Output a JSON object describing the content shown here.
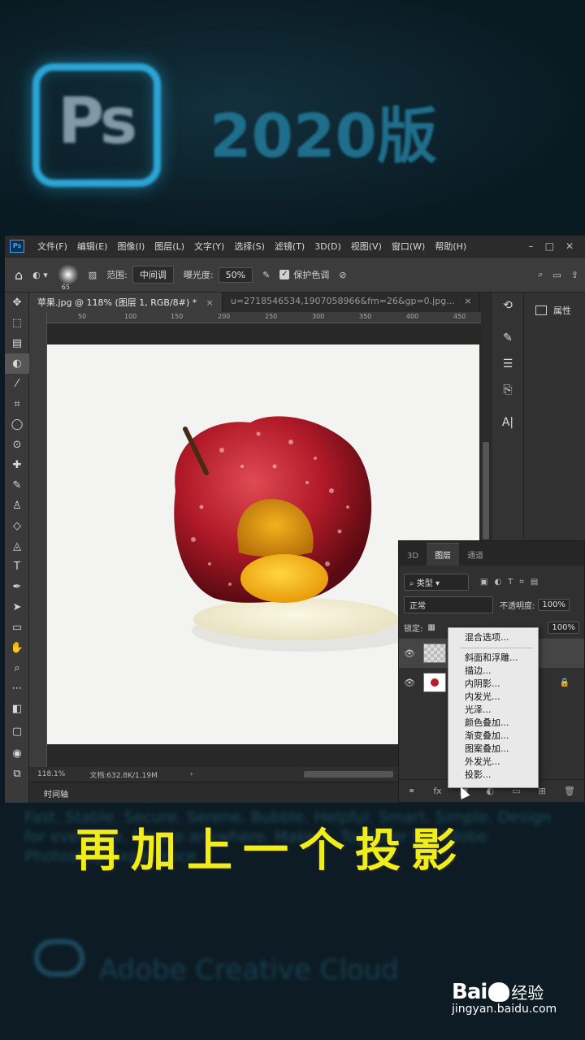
{
  "banner": {
    "logo_text": "Ps",
    "title": "2020版"
  },
  "menu": {
    "app_icon": "Ps",
    "items": [
      "文件(F)",
      "编辑(E)",
      "图像(I)",
      "图层(L)",
      "文字(Y)",
      "选择(S)",
      "滤镜(T)",
      "3D(D)",
      "视图(V)",
      "窗口(W)",
      "帮助(H)"
    ],
    "minimize": "–",
    "maximize": "□",
    "close": "✕"
  },
  "options": {
    "brush_size": "65",
    "range_label": "范围:",
    "range_value": "中间调",
    "exposure_label": "曝光度:",
    "exposure_value": "50%",
    "protect_tones": "保护色调"
  },
  "tabs": [
    {
      "label": "苹果.jpg @ 118% (图层 1, RGB/8#) *",
      "close": "×"
    },
    {
      "label": "u=2718546534,1907058966&fm=26&gp=0.jpg...",
      "close": "×"
    }
  ],
  "ruler_ticks": [
    "50",
    "100",
    "150",
    "200",
    "250",
    "300",
    "350",
    "400",
    "450"
  ],
  "status": {
    "zoom": "118.1%",
    "doc": "文档:632.8K/1.19M",
    "arrow": "›"
  },
  "timeline_label": "时间轴",
  "properties_label": "属性",
  "layers_panel": {
    "tabs": [
      "3D",
      "图层",
      "通道"
    ],
    "filter_type": "类型",
    "blend_mode": "正常",
    "opacity_label": "不透明度:",
    "opacity_value": "100%",
    "lock_label": "锁定:",
    "fill_value": "100%"
  },
  "context_menu": {
    "header": "混合选项...",
    "items": [
      "斜面和浮雕...",
      "描边...",
      "内阴影...",
      "内发光...",
      "光泽...",
      "颜色叠加...",
      "渐变叠加...",
      "图案叠加...",
      "外发光...",
      "投影..."
    ]
  },
  "subtitle": "再加上一个投影",
  "bottom": {
    "blur_text": "Fast. Stable. Secure. Serene. Bubble. Helpful. Smart. Simple. Design for everyone. Create anywhere. Make it. Together for Adobe Photoshop Experience",
    "cc_text": "Adobe Creative Cloud"
  },
  "watermark": {
    "brand": "Bai",
    "brand_suffix": "经验",
    "url": "jingyan.baidu.com"
  },
  "colors": {
    "ps_blue": "#31a8ff",
    "subtitle_yellow": "#f0ee1a",
    "apple_red": "#b81d2a"
  }
}
